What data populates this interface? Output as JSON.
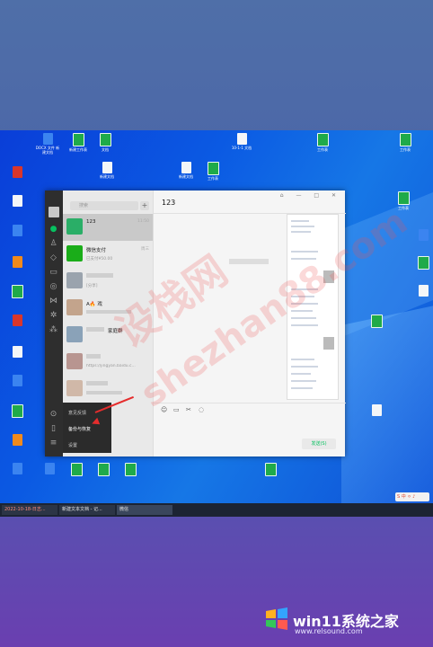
{
  "desktop": {
    "icons": [
      {
        "label": "DOCX 文件\n新建文档",
        "color": "g-blue"
      },
      {
        "label": "新建工作表",
        "color": "g-green"
      },
      {
        "label": "文档",
        "color": "g-green"
      },
      {
        "label": "10-1-1 文档",
        "color": "g-white"
      },
      {
        "label": "工作表",
        "color": "g-green"
      },
      {
        "label": "工作表",
        "color": "g-green"
      },
      {
        "label": "新建文档",
        "color": "g-white"
      },
      {
        "label": "新建文档",
        "color": "g-white"
      },
      {
        "label": "工作表",
        "color": "g-green"
      },
      {
        "label": "工作表",
        "color": "g-green"
      }
    ]
  },
  "wechat": {
    "search_placeholder": "搜索",
    "add_label": "+",
    "chats": [
      {
        "name": "123",
        "preview": "",
        "time": "11:50",
        "avatar_color": "#2aae67"
      },
      {
        "name": "微信支付",
        "preview": "已支付¥50.00",
        "time": "周三",
        "avatar_color": "#1aad19"
      },
      {
        "name": "",
        "preview": "[分享]",
        "time": "",
        "avatar_color": "#9aa3ad"
      },
      {
        "name": "A🔥 戏",
        "preview": "",
        "time": "",
        "avatar_color": "#c3a48c"
      },
      {
        "name": "家庭群",
        "preview": "",
        "time": "",
        "avatar_color": "#8aa2b8"
      },
      {
        "name": "",
        "preview": "https://jingyan.baidu.c...",
        "time": "",
        "avatar_color": "#b89590"
      },
      {
        "name": "",
        "preview": "",
        "time": "",
        "avatar_color": "#d0b8a8"
      },
      {
        "name": "",
        "preview": "",
        "time": "",
        "avatar_color": "#c9c0b5"
      }
    ],
    "menu": [
      "意见反馈",
      "备份与恢复",
      "设置"
    ],
    "chat_title": "123",
    "window_controls": "⌂ — □ ✕",
    "send_label": "发送(S)"
  },
  "taskbar": {
    "items": [
      "2022-10-18-日志...",
      "新建文本文档 - 记...",
      "微信"
    ]
  },
  "tray": "S 中 ⚪ ♪",
  "watermark": {
    "line1": "设栈网",
    "line2": "shezhan88.com"
  },
  "brand": {
    "name": "win11系统之家",
    "url": "www.relsound.com"
  }
}
